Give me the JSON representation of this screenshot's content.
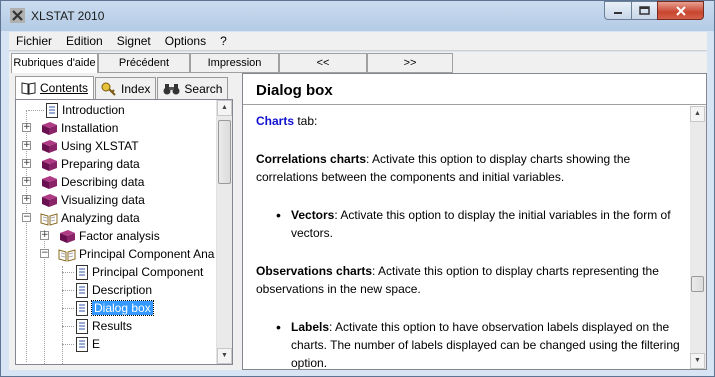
{
  "window": {
    "title": "XLSTAT 2010"
  },
  "menu": {
    "items": [
      "Fichier",
      "Edition",
      "Signet",
      "Options",
      "?"
    ]
  },
  "toolbar": {
    "buttons": [
      "Rubriques d'aide",
      "Précédent",
      "Impression",
      "<<",
      ">>"
    ]
  },
  "tabs": {
    "contents": "Contents",
    "index": "Index",
    "search": "Search"
  },
  "tree": {
    "items": [
      "Introduction",
      "Installation",
      "Using XLSTAT",
      "Preparing data",
      "Describing data",
      "Visualizing data",
      "Analyzing data",
      "Factor analysis",
      "Principal Component Ana",
      "Principal Component",
      "Description",
      "Dialog box",
      "Results",
      "E"
    ]
  },
  "topic": {
    "title": "Dialog box",
    "charts_label": "Charts",
    "charts_tail": " tab:",
    "p1_bold": "Correlations charts",
    "p1_text": ": Activate this option to display charts showing the correlations between the components and initial variables.",
    "b1_bold": "Vectors",
    "b1_text": ": Activate this option to display the initial variables in the form of vectors.",
    "p2_bold": "Observations charts",
    "p2_text": ": Activate this option to display charts representing the observations in the new space.",
    "b2_bold": "Labels",
    "b2_text": ": Activate this option to have observation labels displayed on the charts. The number of labels displayed can be changed using the filtering option."
  },
  "colors": {
    "link": "#1010d0",
    "selection": "#3399ff",
    "book": "#7a1a5a"
  }
}
